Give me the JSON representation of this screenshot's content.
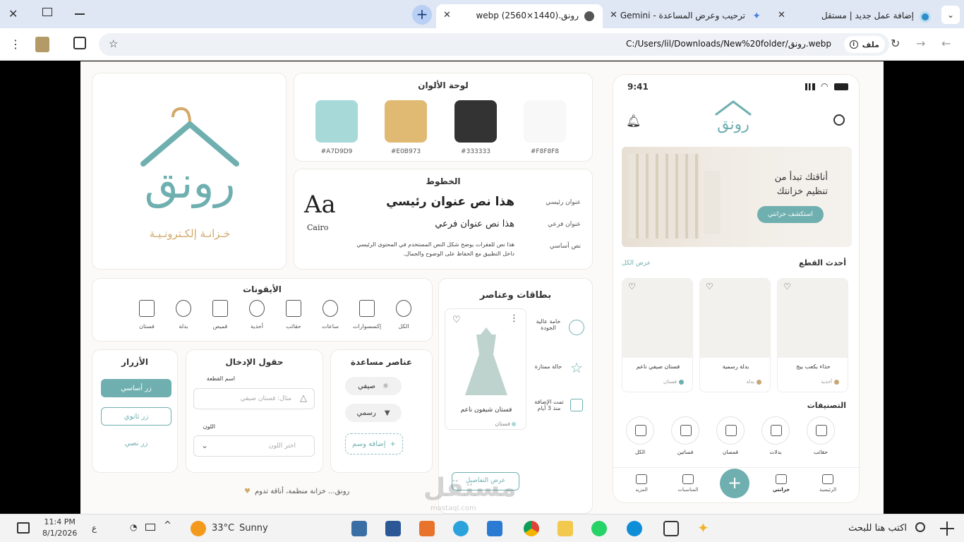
{
  "browser": {
    "tabs": [
      {
        "label": "إضافة عمل جديد | مستقل"
      },
      {
        "label": "ترحيب وعرض المساعدة - Gemini"
      },
      {
        "label": "رونق.webp (2560×1440)"
      }
    ],
    "address_prefix": "ملف",
    "url": "C:/Users/lil/Downloads/New%20folder/رونق.webp"
  },
  "brand": {
    "name": "رونق",
    "tagline": "خـزانـة إلكـترونـيـة",
    "footer": "رونق... خزانة منظمة، أناقة تدوم"
  },
  "palette": {
    "title": "لوحة الألوان",
    "colors": [
      {
        "hex": "#A7D9D9"
      },
      {
        "hex": "#E0B973"
      },
      {
        "hex": "#333333"
      },
      {
        "hex": "#F8F8F8"
      }
    ]
  },
  "fonts": {
    "title": "الخطوط",
    "sample": "Aa",
    "family": "Cairo",
    "rows": [
      {
        "label": "عنوان رئيسي",
        "text": "هذا نص عنوان رئيسي"
      },
      {
        "label": "عنوان فرعي",
        "text": "هذا نص عنوان فرعي"
      },
      {
        "label": "نص أساسي",
        "text": "هذا نص للفقرات يوضح شكل النص المستخدم في المحتوى الرئيسي داخل التطبيق مع الحفاظ على الوضوح والجمال."
      }
    ]
  },
  "icons": {
    "title": "الأيقونات",
    "items": [
      {
        "label": "الكل",
        "icon": "hanger-icon"
      },
      {
        "label": "إكسسوارات",
        "icon": "chat-bubble-icon"
      },
      {
        "label": "ساعات",
        "icon": "watch-icon"
      },
      {
        "label": "حقائب",
        "icon": "bag-icon"
      },
      {
        "label": "أحذية",
        "icon": "shoe-icon"
      },
      {
        "label": "قميص",
        "icon": "shirt-icon"
      },
      {
        "label": "بدلة",
        "icon": "suit-icon"
      },
      {
        "label": "فستان",
        "icon": "dress-icon"
      }
    ]
  },
  "cards_section": {
    "title": "بطاقات وعناصر",
    "features": [
      {
        "label": "خامة عالية الجودة",
        "icon": "badge-icon"
      },
      {
        "label": "حالة ممتازة",
        "icon": "star-icon"
      },
      {
        "label": "تمت الإضافة منذ 3 أيام",
        "icon": "calendar-icon"
      }
    ],
    "card": {
      "name": "فستان شيفون ناعم",
      "category": "فستان",
      "details_button": "عرض التفاصيل"
    }
  },
  "buttons": {
    "title": "الأزرار",
    "primary": "زر أساسي",
    "secondary": "زر ثانوي",
    "text": "زر نصي"
  },
  "inputs": {
    "title": "حقول الإدخال",
    "name_label": "اسم القطعة",
    "name_placeholder": "مثال: فستان صيفي",
    "color_label": "اللون",
    "color_placeholder": "اختر اللون"
  },
  "helpers": {
    "title": "عناصر مساعدة",
    "chips": [
      {
        "label": "صيفي",
        "icon": "sun-icon"
      },
      {
        "label": "رسمي",
        "icon": "tie-icon"
      }
    ],
    "add_tag": "إضافة وسم"
  },
  "phone": {
    "time": "9:41",
    "banner_title": "أناقتك تبدأ من تنظيم خزانتك",
    "banner_button": "استكشف خزانتي",
    "latest_title": "أحدث القطع",
    "see_all": "عرض الكل",
    "products": [
      {
        "name": "حذاء بكعب بيج",
        "category": "أحذية",
        "dot": "#C8A576"
      },
      {
        "name": "بدلة رسمية",
        "category": "بدلة",
        "dot": "#C8A576"
      },
      {
        "name": "فستان صيفي ناعم",
        "category": "فستان",
        "dot": "#6FAFB0"
      }
    ],
    "categories_title": "التصنيفات",
    "categories": [
      {
        "label": "حقائب",
        "icon": "bag-icon"
      },
      {
        "label": "بدلات",
        "icon": "suit-icon"
      },
      {
        "label": "قمصان",
        "icon": "shirt-icon"
      },
      {
        "label": "فساتين",
        "icon": "dress-icon"
      },
      {
        "label": "الكل",
        "icon": "hanger-icon"
      }
    ],
    "nav": [
      {
        "label": "الرئيسية",
        "icon": "home-icon"
      },
      {
        "label": "خزانتي",
        "icon": "hanger-icon"
      },
      {
        "label": "",
        "icon": "plus-icon"
      },
      {
        "label": "المناسبات",
        "icon": "calendar-star-icon"
      },
      {
        "label": "المزيد",
        "icon": "more-icon"
      }
    ]
  },
  "watermark": {
    "text": "مستقل",
    "sub": "mostaql.com"
  },
  "taskbar": {
    "search": "اكتب هنا للبحث",
    "temp": "33°C",
    "weather": "Sunny",
    "time": "11:4 PM",
    "date": "8/1/2026",
    "lang": "ع"
  },
  "colors": {
    "teal": "#6FAFB0",
    "gold": "#E0B973"
  }
}
